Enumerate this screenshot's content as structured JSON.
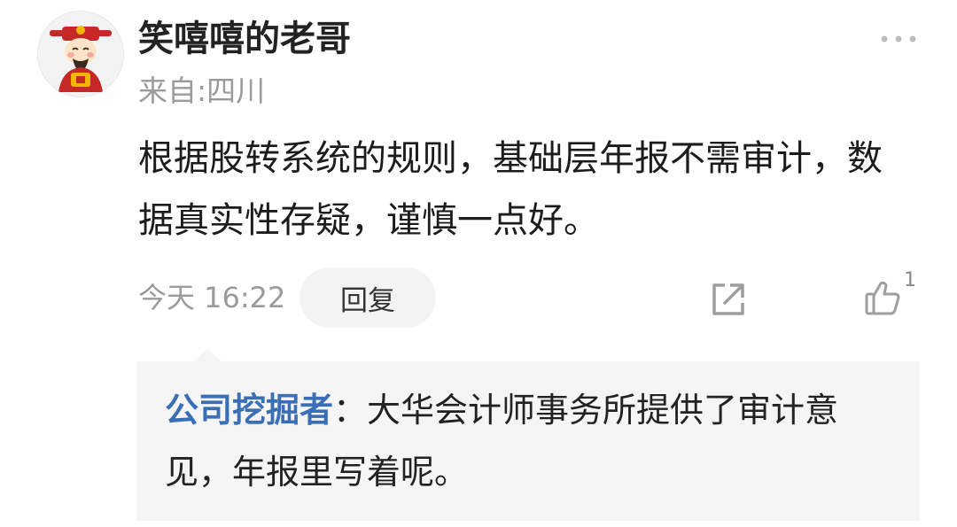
{
  "user": {
    "name": "笑嘻嘻的老哥",
    "location": "来自:四川"
  },
  "comment": {
    "text": "根据股转系统的规则，基础层年报不需审计，数据真实性存疑，谨慎一点好。",
    "time": "今天 16:22",
    "like_count": "1"
  },
  "actions": {
    "reply_label": "回复",
    "more_icon": "more-dots-icon",
    "share_icon": "share-icon",
    "like_icon": "thumb-up-icon"
  },
  "reply": {
    "author": "公司挖掘者",
    "separator": "：",
    "text": "大华会计师事务所提供了审计意见，年报里写着呢。"
  },
  "colors": {
    "username": "#222222",
    "secondary_text": "#9b9b9b",
    "reply_author": "#3a6fb5",
    "reply_background": "#f5f5f5",
    "reply_button_background": "#f3f3f3"
  }
}
